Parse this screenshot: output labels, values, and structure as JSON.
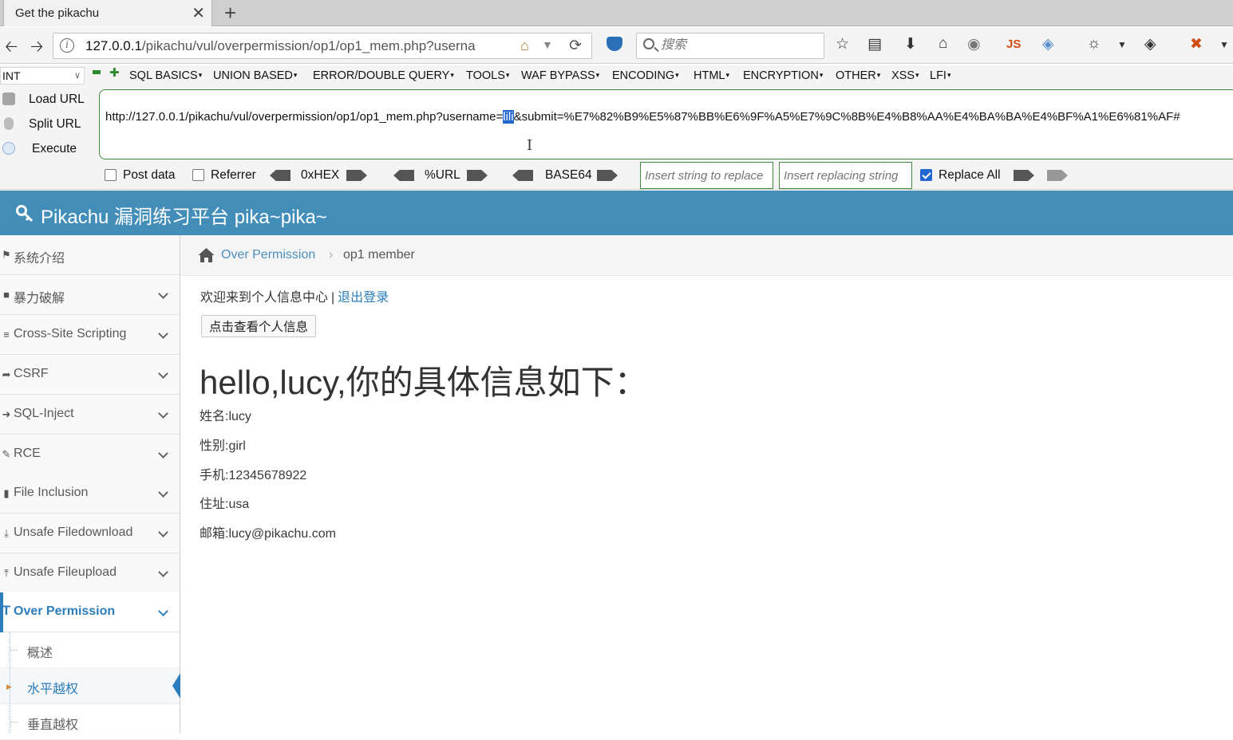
{
  "browser": {
    "tab_title": "Get the pikachu",
    "tab_close": "✕",
    "new_tab": "+",
    "url_prefix": "127.0.0.1",
    "url_rest": "/pikachu/vul/overpermission/op1/op1_mem.php?userna",
    "search_placeholder": "搜索"
  },
  "hackbar": {
    "type_select": "INT",
    "menus": [
      "SQL BASICS",
      "UNION BASED",
      "ERROR/DOUBLE QUERY",
      "TOOLS",
      "WAF BYPASS",
      "ENCODING",
      "HTML",
      "ENCRYPTION",
      "OTHER",
      "XSS",
      "LFI"
    ],
    "load_url": "Load URL",
    "split_url": "Split URL",
    "execute": "Execute",
    "url_before": "http://127.0.0.1/pikachu/vul/overpermission/op1/op1_mem.php?username=",
    "url_selected": "lili",
    "url_after": "&submit=%E7%82%B9%E5%87%BB%E6%9F%A5%E7%9C%8B%E4%B8%AA%E4%BA%BA%E4%BF%A1%E6%81%AF#",
    "post_data": "Post data",
    "referrer": "Referrer",
    "hex": "0xHEX",
    "url_enc": "%URL",
    "base64": "BASE64",
    "replace_from_placeholder": "Insert string to replace",
    "replace_to_placeholder": "Insert replacing string",
    "replace_all": "Replace All"
  },
  "site": {
    "title": "Pikachu 漏洞练习平台 pika~pika~"
  },
  "sidebar": {
    "items": [
      {
        "label": "系统介绍",
        "icon": "tag-icon"
      },
      {
        "label": "暴力破解",
        "icon": "lock-icon"
      },
      {
        "label": "Cross-Site Scripting",
        "icon": "bars-icon"
      },
      {
        "label": "CSRF",
        "icon": "share-icon"
      },
      {
        "label": "SQL-Inject",
        "icon": "arrow-icon"
      },
      {
        "label": "RCE",
        "icon": "pencil-icon"
      },
      {
        "label": "File Inclusion",
        "icon": "file-icon"
      },
      {
        "label": "Unsafe Filedownload",
        "icon": "download-icon"
      },
      {
        "label": "Unsafe Fileupload",
        "icon": "upload-icon"
      },
      {
        "label": "Over Permission",
        "icon": "text-icon"
      }
    ],
    "subitems": [
      "概述",
      "水平越权",
      "垂直越权"
    ]
  },
  "breadcrumb": {
    "link": "Over Permission",
    "sep": "›",
    "current": "op1 member"
  },
  "main": {
    "welcome": "欢迎来到个人信息中心",
    "separator": "|",
    "logout": "退出登录",
    "view_button": "点击查看个人信息",
    "hello": "hello,lucy,你的具体信息如下：",
    "info": [
      "姓名:lucy",
      "性别:girl",
      "手机:12345678922",
      "住址:usa",
      "邮箱:lucy@pikachu.com"
    ]
  },
  "colors": {
    "header_bg": "#438eb9",
    "accent": "#2b7dbc",
    "hackbar_green": "#3f8a3f"
  }
}
